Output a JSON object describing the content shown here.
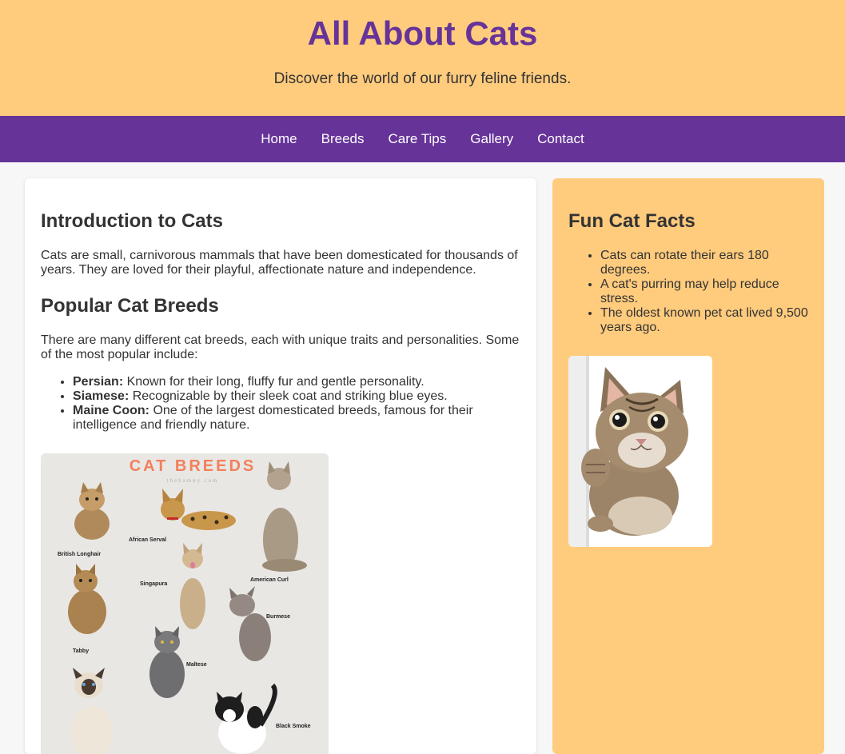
{
  "header": {
    "title": "All About Cats",
    "subtitle": "Discover the world of our furry feline friends."
  },
  "nav": {
    "items": [
      "Home",
      "Breeds",
      "Care Tips",
      "Gallery",
      "Contact"
    ]
  },
  "main": {
    "intro_heading": "Introduction to Cats",
    "intro_text": "Cats are small, carnivorous mammals that have been domesticated for thousands of years. They are loved for their playful, affectionate nature and independence.",
    "breeds_heading": "Popular Cat Breeds",
    "breeds_text": "There are many different cat breeds, each with unique traits and personalities. Some of the most popular include:",
    "breeds": [
      {
        "name": "Persian:",
        "desc": " Known for their long, fluffy fur and gentle personality."
      },
      {
        "name": "Siamese:",
        "desc": " Recognizable by their sleek coat and striking blue eyes."
      },
      {
        "name": "Maine Coon:",
        "desc": " One of the largest domesticated breeds, famous for their intelligence and friendly nature."
      }
    ],
    "breeds_image": {
      "title": "CAT BREEDS",
      "site": "thehamny.com",
      "labels": [
        "British Longhair",
        "African Serval",
        "American Curl",
        "Singapura",
        "Burmese",
        "Tabby",
        "Maltese",
        "Black Smoke"
      ]
    }
  },
  "sidebar": {
    "heading": "Fun Cat Facts",
    "facts": [
      "Cats can rotate their ears 180 degrees.",
      "A cat's purring may help reduce stress.",
      "The oldest known pet cat lived 9,500 years ago."
    ]
  },
  "colors": {
    "accent": "#663399",
    "header_bg": "#ffcb7d",
    "sidebar_bg": "#ffcb7d",
    "text": "#333333"
  }
}
